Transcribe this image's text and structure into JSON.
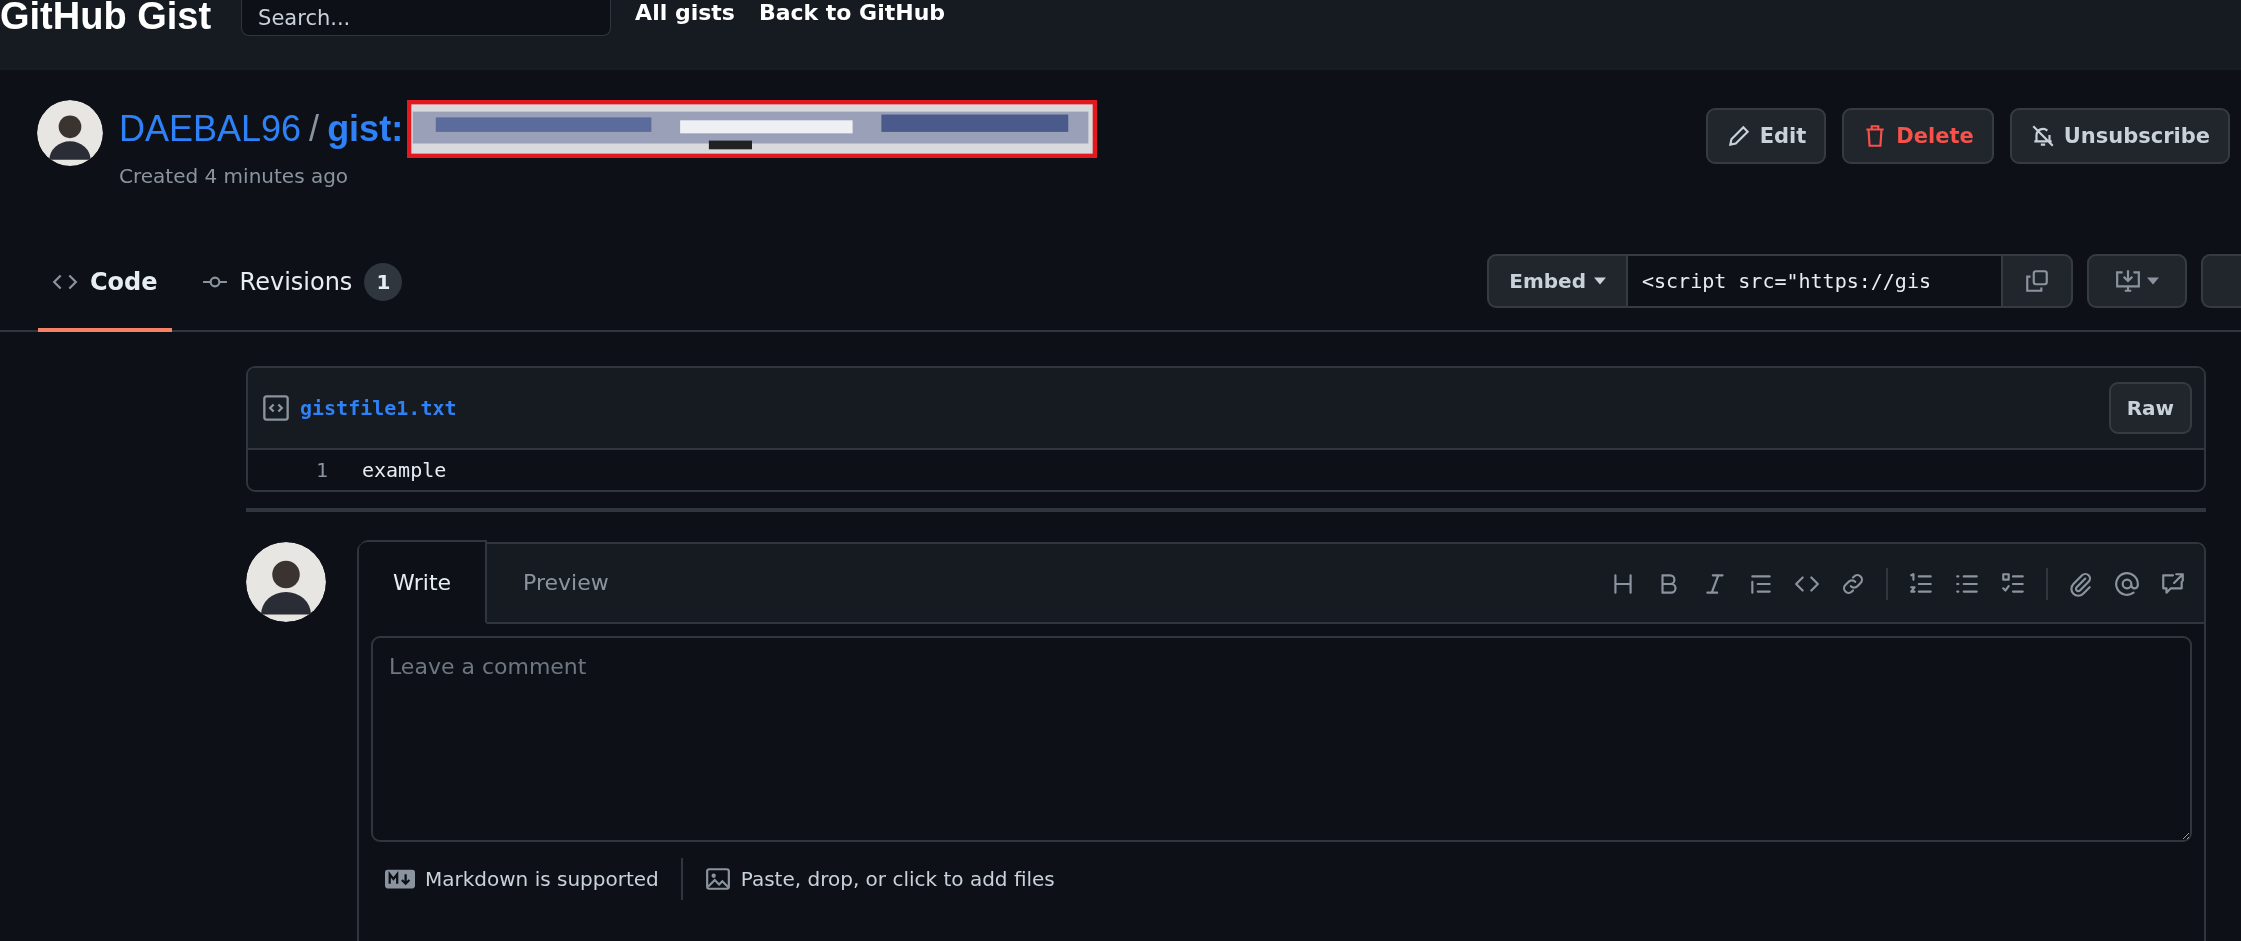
{
  "header": {
    "logo": "GitHub Gist",
    "search": {
      "placeholder": "Search..."
    },
    "nav": [
      "All gists",
      "Back to GitHub"
    ]
  },
  "gist": {
    "owner": "DAEBAL96",
    "separator": "/",
    "name": "gist:",
    "created": "Created 4 minutes ago",
    "actions": [
      {
        "label": "Edit",
        "kind": "edit"
      },
      {
        "label": "Delete",
        "kind": "delete"
      },
      {
        "label": "Unsubscribe",
        "kind": "unsubscribe"
      }
    ]
  },
  "tabs": [
    {
      "label": "Code",
      "kind": "code",
      "selected": true
    },
    {
      "label": "Revisions",
      "kind": "revisions",
      "count": "1",
      "selected": false
    }
  ],
  "embed": {
    "mode": "Embed",
    "value": "<script src=\"https://gis"
  },
  "file": {
    "name": "gistfile1.txt",
    "raw": "Raw",
    "lines": [
      {
        "number": "1",
        "text": "example"
      }
    ]
  },
  "comment": {
    "tabs": [
      {
        "label": "Write",
        "selected": true
      },
      {
        "label": "Preview",
        "selected": false
      }
    ],
    "placeholder": "Leave a comment",
    "footer": [
      {
        "kind": "markdown",
        "text": "Markdown is supported"
      },
      {
        "kind": "attach",
        "text": "Paste, drop, or click to add files"
      }
    ]
  }
}
